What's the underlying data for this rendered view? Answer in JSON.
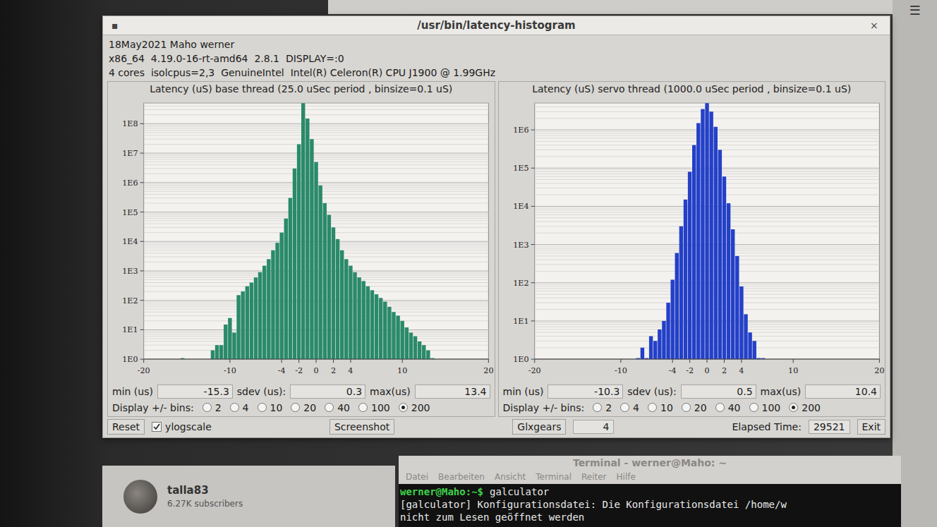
{
  "desktop": {
    "menu_icon": "☰"
  },
  "window": {
    "title": "/usr/bin/latency-histogram",
    "menu_glyph": "▪",
    "close": "×"
  },
  "info": [
    "18May2021 Maho werner",
    "x86_64  4.19.0-16-rt-amd64  2.8.1  DISPLAY=:0",
    "4 cores  isolcpus=2,3  GenuineIntel  Intel(R) Celeron(R) CPU J1900 @ 1.99GHz"
  ],
  "panels": [
    {
      "title": "Latency (uS) base thread (25.0 uSec period , binsize=0.1 uS)",
      "color": "#2a8a6a",
      "y_ticks": [
        "1E0",
        "1E1",
        "1E2",
        "1E3",
        "1E4",
        "1E5",
        "1E6",
        "1E7",
        "1E8"
      ],
      "x_ticks": [
        "-20",
        "-10",
        "-4",
        "-2",
        "0",
        "2",
        "4",
        "10",
        "20"
      ],
      "values": [
        0,
        0,
        0,
        0,
        0,
        0,
        0,
        0,
        0,
        1,
        0,
        0,
        0,
        0,
        0,
        0,
        2,
        3,
        3,
        15,
        25,
        8,
        150,
        200,
        300,
        400,
        600,
        900,
        1500,
        2500,
        5000,
        9000,
        20000,
        60000,
        300000,
        3000000,
        20000000,
        500000000,
        150000000,
        30000000,
        5000000,
        800000,
        200000,
        80000,
        30000,
        12000,
        5000,
        2500,
        1500,
        900,
        600,
        450,
        300,
        220,
        160,
        120,
        90,
        60,
        40,
        30,
        20,
        12,
        8,
        6,
        4,
        3,
        2,
        1,
        0,
        0,
        0,
        0,
        0,
        0,
        0,
        0,
        0,
        0,
        0,
        0,
        0
      ],
      "stats": [
        {
          "label": "min (us)",
          "value": "-15.3"
        },
        {
          "label": "sdev (us):",
          "value": "0.3"
        },
        {
          "label": "max(us)",
          "value": "13.4"
        }
      ],
      "bins_label": "Display +/- bins:",
      "bins": [
        {
          "label": "2",
          "selected": false
        },
        {
          "label": "4",
          "selected": false
        },
        {
          "label": "10",
          "selected": false
        },
        {
          "label": "20",
          "selected": false
        },
        {
          "label": "40",
          "selected": false
        },
        {
          "label": "100",
          "selected": false
        },
        {
          "label": "200",
          "selected": true
        }
      ]
    },
    {
      "title": "Latency (uS) servo thread (1000.0 uSec period , binsize=0.1 uS)",
      "color": "#2440c8",
      "y_ticks": [
        "1E0",
        "1E1",
        "1E2",
        "1E3",
        "1E4",
        "1E5",
        "1E6"
      ],
      "x_ticks": [
        "-20",
        "-10",
        "-4",
        "-2",
        "0",
        "2",
        "4",
        "10",
        "20"
      ],
      "values": [
        0,
        0,
        0,
        0,
        0,
        0,
        0,
        0,
        0,
        0,
        0,
        0,
        0,
        0,
        0,
        0,
        0,
        0,
        0,
        0,
        0,
        0,
        0,
        0,
        1,
        2,
        1,
        4,
        3,
        6,
        10,
        30,
        120,
        600,
        3000,
        15000,
        80000,
        400000,
        1500000,
        3500000,
        5000000,
        3000000,
        1200000,
        300000,
        60000,
        12000,
        2500,
        500,
        80,
        15,
        5,
        3,
        1,
        1,
        0,
        0,
        0,
        0,
        0,
        0,
        0,
        0,
        0,
        0,
        0,
        0,
        0,
        0,
        0,
        0,
        0,
        0,
        0,
        0,
        0,
        0,
        0,
        0,
        0,
        0,
        0
      ],
      "stats": [
        {
          "label": "min (us)",
          "value": "-10.3"
        },
        {
          "label": "sdev (us):",
          "value": "0.5"
        },
        {
          "label": "max(us)",
          "value": "10.4"
        }
      ],
      "bins_label": "Display +/- bins:",
      "bins": [
        {
          "label": "2",
          "selected": false
        },
        {
          "label": "4",
          "selected": false
        },
        {
          "label": "10",
          "selected": false
        },
        {
          "label": "20",
          "selected": false
        },
        {
          "label": "40",
          "selected": false
        },
        {
          "label": "100",
          "selected": false
        },
        {
          "label": "200",
          "selected": true
        }
      ]
    }
  ],
  "controls": {
    "reset": "Reset",
    "ylogscale": {
      "label": "ylogscale",
      "checked": true
    },
    "screenshot": "Screenshot",
    "glxgears": {
      "label": "Glxgears",
      "value": "4"
    },
    "elapsed": {
      "label": "Elapsed Time:",
      "value": "29521"
    },
    "exit": "Exit"
  },
  "channel": {
    "name": "talla83",
    "subscribers": "6.27K subscribers"
  },
  "terminal": {
    "title": "Terminal - werner@Maho: ~",
    "menu": [
      "Datei",
      "Bearbeiten",
      "Ansicht",
      "Terminal",
      "Reiter",
      "Hilfe"
    ],
    "lines": [
      {
        "prompt": "werner@Maho:~$",
        "text": "galculator"
      },
      {
        "prompt": "",
        "text": "[galculator] Konfigurationsdatei: Die Konfigurationsdatei /home/w"
      },
      {
        "prompt": "",
        "text": "nicht zum Lesen geöffnet werden"
      }
    ]
  }
}
